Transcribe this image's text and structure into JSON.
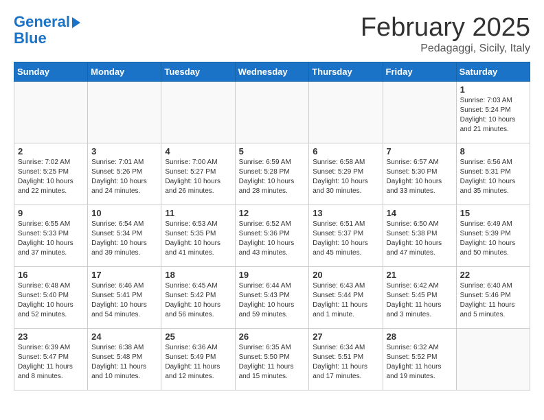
{
  "header": {
    "logo_line1": "General",
    "logo_line2": "Blue",
    "month_title": "February 2025",
    "location": "Pedagaggi, Sicily, Italy"
  },
  "weekdays": [
    "Sunday",
    "Monday",
    "Tuesday",
    "Wednesday",
    "Thursday",
    "Friday",
    "Saturday"
  ],
  "weeks": [
    [
      {
        "day": "",
        "info": ""
      },
      {
        "day": "",
        "info": ""
      },
      {
        "day": "",
        "info": ""
      },
      {
        "day": "",
        "info": ""
      },
      {
        "day": "",
        "info": ""
      },
      {
        "day": "",
        "info": ""
      },
      {
        "day": "1",
        "info": "Sunrise: 7:03 AM\nSunset: 5:24 PM\nDaylight: 10 hours and 21 minutes."
      }
    ],
    [
      {
        "day": "2",
        "info": "Sunrise: 7:02 AM\nSunset: 5:25 PM\nDaylight: 10 hours and 22 minutes."
      },
      {
        "day": "3",
        "info": "Sunrise: 7:01 AM\nSunset: 5:26 PM\nDaylight: 10 hours and 24 minutes."
      },
      {
        "day": "4",
        "info": "Sunrise: 7:00 AM\nSunset: 5:27 PM\nDaylight: 10 hours and 26 minutes."
      },
      {
        "day": "5",
        "info": "Sunrise: 6:59 AM\nSunset: 5:28 PM\nDaylight: 10 hours and 28 minutes."
      },
      {
        "day": "6",
        "info": "Sunrise: 6:58 AM\nSunset: 5:29 PM\nDaylight: 10 hours and 30 minutes."
      },
      {
        "day": "7",
        "info": "Sunrise: 6:57 AM\nSunset: 5:30 PM\nDaylight: 10 hours and 33 minutes."
      },
      {
        "day": "8",
        "info": "Sunrise: 6:56 AM\nSunset: 5:31 PM\nDaylight: 10 hours and 35 minutes."
      }
    ],
    [
      {
        "day": "9",
        "info": "Sunrise: 6:55 AM\nSunset: 5:33 PM\nDaylight: 10 hours and 37 minutes."
      },
      {
        "day": "10",
        "info": "Sunrise: 6:54 AM\nSunset: 5:34 PM\nDaylight: 10 hours and 39 minutes."
      },
      {
        "day": "11",
        "info": "Sunrise: 6:53 AM\nSunset: 5:35 PM\nDaylight: 10 hours and 41 minutes."
      },
      {
        "day": "12",
        "info": "Sunrise: 6:52 AM\nSunset: 5:36 PM\nDaylight: 10 hours and 43 minutes."
      },
      {
        "day": "13",
        "info": "Sunrise: 6:51 AM\nSunset: 5:37 PM\nDaylight: 10 hours and 45 minutes."
      },
      {
        "day": "14",
        "info": "Sunrise: 6:50 AM\nSunset: 5:38 PM\nDaylight: 10 hours and 47 minutes."
      },
      {
        "day": "15",
        "info": "Sunrise: 6:49 AM\nSunset: 5:39 PM\nDaylight: 10 hours and 50 minutes."
      }
    ],
    [
      {
        "day": "16",
        "info": "Sunrise: 6:48 AM\nSunset: 5:40 PM\nDaylight: 10 hours and 52 minutes."
      },
      {
        "day": "17",
        "info": "Sunrise: 6:46 AM\nSunset: 5:41 PM\nDaylight: 10 hours and 54 minutes."
      },
      {
        "day": "18",
        "info": "Sunrise: 6:45 AM\nSunset: 5:42 PM\nDaylight: 10 hours and 56 minutes."
      },
      {
        "day": "19",
        "info": "Sunrise: 6:44 AM\nSunset: 5:43 PM\nDaylight: 10 hours and 59 minutes."
      },
      {
        "day": "20",
        "info": "Sunrise: 6:43 AM\nSunset: 5:44 PM\nDaylight: 11 hours and 1 minute."
      },
      {
        "day": "21",
        "info": "Sunrise: 6:42 AM\nSunset: 5:45 PM\nDaylight: 11 hours and 3 minutes."
      },
      {
        "day": "22",
        "info": "Sunrise: 6:40 AM\nSunset: 5:46 PM\nDaylight: 11 hours and 5 minutes."
      }
    ],
    [
      {
        "day": "23",
        "info": "Sunrise: 6:39 AM\nSunset: 5:47 PM\nDaylight: 11 hours and 8 minutes."
      },
      {
        "day": "24",
        "info": "Sunrise: 6:38 AM\nSunset: 5:48 PM\nDaylight: 11 hours and 10 minutes."
      },
      {
        "day": "25",
        "info": "Sunrise: 6:36 AM\nSunset: 5:49 PM\nDaylight: 11 hours and 12 minutes."
      },
      {
        "day": "26",
        "info": "Sunrise: 6:35 AM\nSunset: 5:50 PM\nDaylight: 11 hours and 15 minutes."
      },
      {
        "day": "27",
        "info": "Sunrise: 6:34 AM\nSunset: 5:51 PM\nDaylight: 11 hours and 17 minutes."
      },
      {
        "day": "28",
        "info": "Sunrise: 6:32 AM\nSunset: 5:52 PM\nDaylight: 11 hours and 19 minutes."
      },
      {
        "day": "",
        "info": ""
      }
    ]
  ]
}
